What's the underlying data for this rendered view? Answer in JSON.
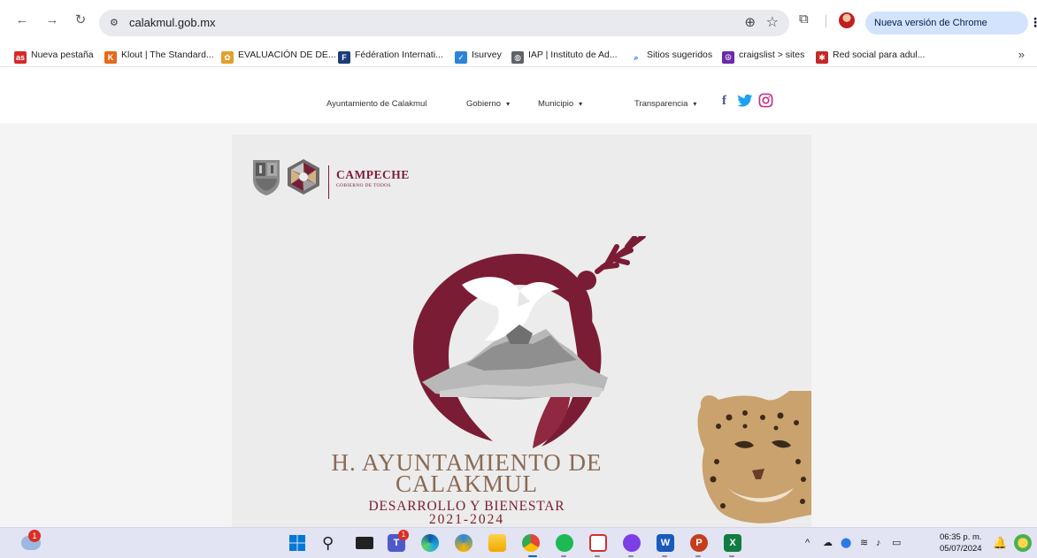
{
  "browser": {
    "url": "calakmul.gob.mx",
    "update_label": "Nueva versión de Chrome disponible"
  },
  "bookmarks": [
    {
      "label": "Nueva pestaña",
      "icon": "as-icon",
      "color": "#d42a2a",
      "glyph": "as"
    },
    {
      "label": "Klout | The Standard...",
      "icon": "klout-icon",
      "color": "#e46a1b",
      "glyph": "K"
    },
    {
      "label": "EVALUACIÓN DE DE...",
      "icon": "medal-icon",
      "color": "#e0a030",
      "glyph": "✿"
    },
    {
      "label": "Fédération Internati...",
      "icon": "fei-icon",
      "color": "#1c3d7a",
      "glyph": "F"
    },
    {
      "label": "Isurvey",
      "icon": "check-icon",
      "color": "#2b84d8",
      "glyph": "✓"
    },
    {
      "label": "IAP | Instituto de Ad...",
      "icon": "globe-icon",
      "color": "#5f6368",
      "glyph": "◍"
    },
    {
      "label": "Sitios sugeridos",
      "icon": "search-icon",
      "color": "#1a73e8",
      "glyph": "⌕"
    },
    {
      "label": "craigslist > sites",
      "icon": "peace-icon",
      "color": "#6c2aa8",
      "glyph": "☮"
    },
    {
      "label": "Red social para adul...",
      "icon": "red-social-icon",
      "color": "#c62828",
      "glyph": "✱"
    }
  ],
  "site": {
    "nav": [
      {
        "label": "Ayuntamiento de Calakmul",
        "caret": ""
      },
      {
        "label": "Gobierno",
        "caret": "▾"
      },
      {
        "label": "Municipio",
        "caret": "▾"
      },
      {
        "label": "Transparencia",
        "caret": "▾"
      }
    ],
    "social": {
      "facebook": "f",
      "twitter": "🐦",
      "instagram": "◎"
    },
    "poster": {
      "campeche": "CAMPECHE",
      "campeche_sub": "GOBIERNO DE TODOS",
      "title_line1": "H. AYUNTAMIENTO DE",
      "title_line2": "CALAKMUL",
      "subtitle": "DESARROLLO Y BIENESTAR",
      "years": "2021-2024"
    }
  },
  "taskbar": {
    "weather_badge": "1",
    "teams_badge": "1",
    "time": "06:35 p. m.",
    "date": "05/07/2024"
  },
  "colors": {
    "brand_maroon": "#7b1c35",
    "poster_bg": "#ececec",
    "chrome_pill": "#d3e3fd"
  }
}
